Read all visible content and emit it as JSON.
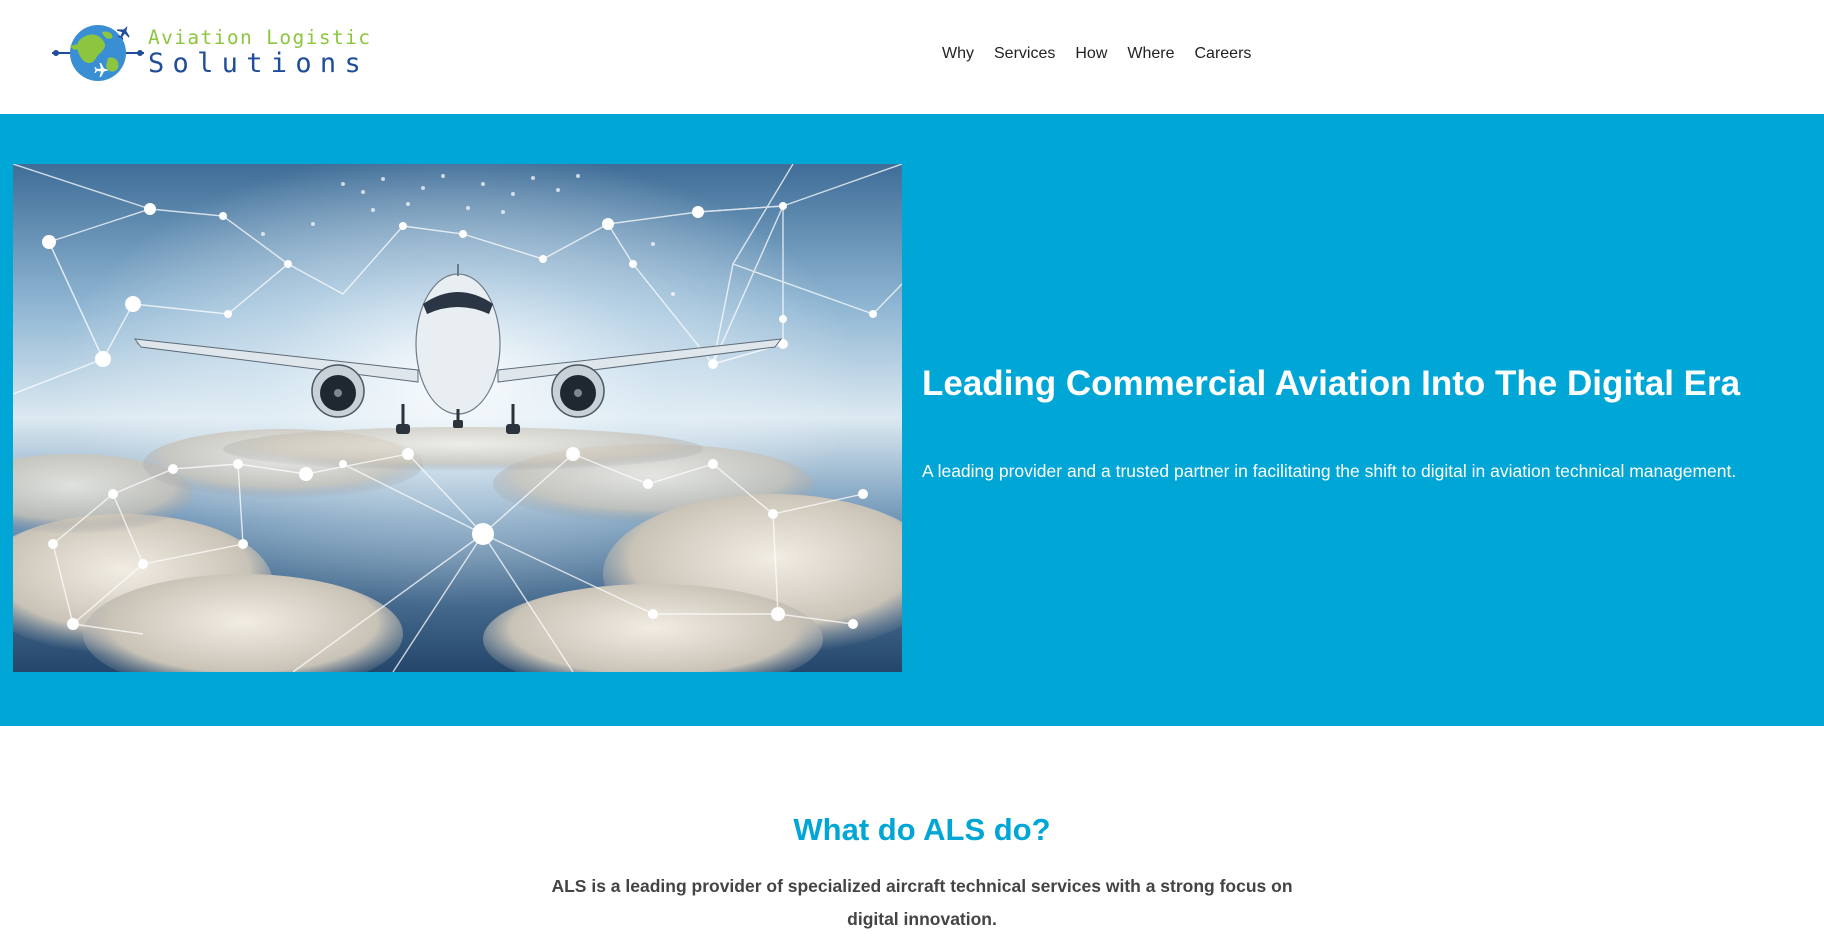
{
  "header": {
    "logo": {
      "line1": "Aviation Logistic",
      "line2": "Solutions",
      "colors": {
        "green": "#8cc63f",
        "blue": "#1f4d99"
      }
    },
    "nav": [
      {
        "label": "Why"
      },
      {
        "label": "Services"
      },
      {
        "label": "How"
      },
      {
        "label": "Where"
      },
      {
        "label": "Careers"
      }
    ]
  },
  "hero": {
    "background_color": "#00a6d6",
    "image_subject": "airplane-network-clouds",
    "title": "Leading Commercial Aviation Into The Digital Era",
    "subtitle": "A leading provider and a trusted partner in facilitating the shift to digital in aviation technical management."
  },
  "what": {
    "heading": "What do ALS do?",
    "text": "ALS is a leading provider of specialized aircraft technical services with a strong focus on digital innovation.",
    "heading_color": "#00a6d6"
  }
}
